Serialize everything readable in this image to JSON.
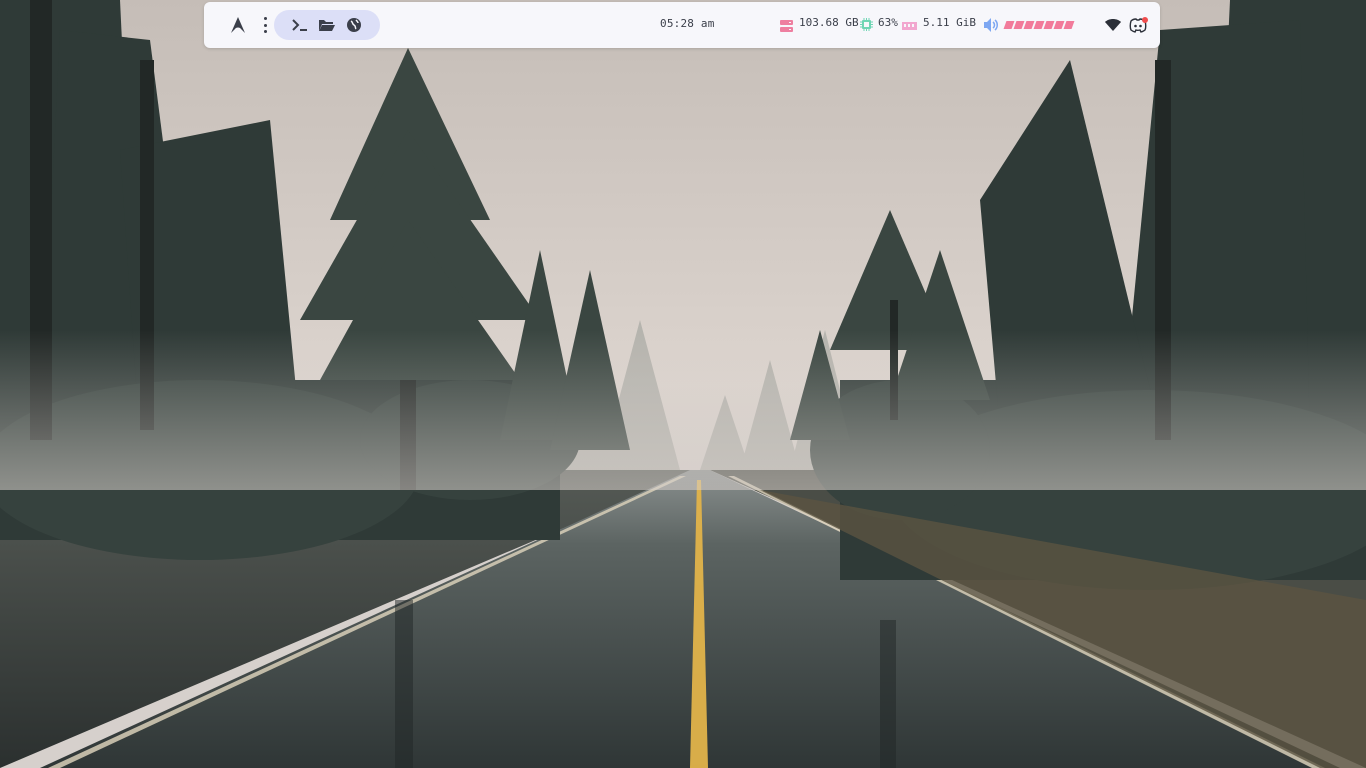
{
  "topbar": {
    "launcher_icons": [
      "arch-logo-icon",
      "more-vertical-icon",
      "terminal-icon",
      "folder-open-icon",
      "globe-icon"
    ],
    "clock": "05:28 am",
    "disk": {
      "icon": "hard-drive-icon",
      "value": "103.68 GB",
      "color": "#ee7fa0"
    },
    "cpu": {
      "icon": "cpu-icon",
      "value": "63%",
      "color": "#6fd6b4"
    },
    "memory": {
      "icon": "memory-icon",
      "value": "5.11 GiB",
      "color": "#f2a7cf"
    },
    "volume": {
      "icon": "speaker-icon",
      "level": 1.0,
      "segments": 7,
      "color": "#f27b9b",
      "icon_color": "#7da7f2"
    },
    "tray": [
      "wifi-icon",
      "discord-icon"
    ]
  },
  "colors": {
    "bar_bg": "#f7f7fb",
    "launcher_bg": "#dcdff7",
    "text": "#3b3f4a"
  },
  "wallpaper": "Misty forest road in the rain"
}
